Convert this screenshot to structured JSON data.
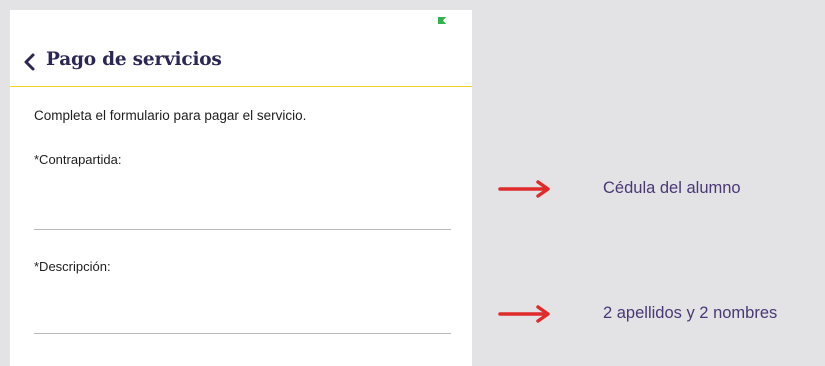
{
  "app_bar": {
    "back_icon": "chevron-left-icon",
    "title": "Pago de servicios"
  },
  "status_bar": {
    "indicator_icon": "flag-icon",
    "indicator_color": "#2fb34a"
  },
  "form": {
    "intro": "Completa el formulario para pagar el servicio.",
    "fields": [
      {
        "label": "*Contrapartida:",
        "value": "",
        "placeholder": ""
      },
      {
        "label": "*Descripción:",
        "value": "",
        "placeholder": ""
      }
    ]
  },
  "annotations": [
    {
      "icon": "arrow-right-icon",
      "text": "Cédula del alumno",
      "color": "#e02b2b"
    },
    {
      "icon": "arrow-right-icon",
      "text": "2 apellidos y 2 nombres",
      "color": "#e02b2b"
    }
  ],
  "colors": {
    "header_underline": "#f2d21f",
    "title": "#2c2654",
    "annotation_text": "#4a3776",
    "background": "#e3e3e5"
  }
}
